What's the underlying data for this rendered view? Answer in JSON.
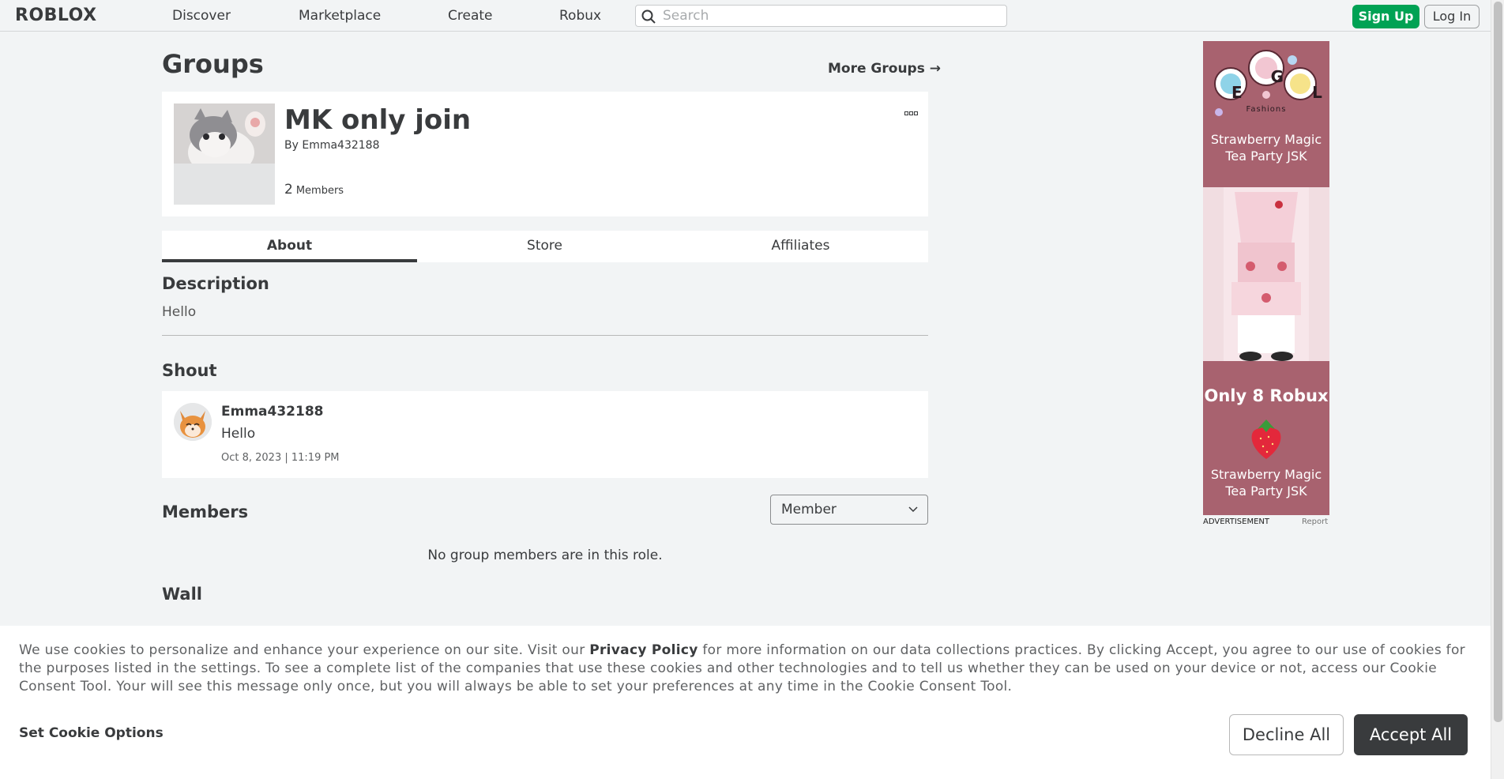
{
  "nav": {
    "logo": "ROBLOX",
    "links": [
      "Discover",
      "Marketplace",
      "Create",
      "Robux"
    ],
    "search_placeholder": "Search",
    "signup": "Sign Up",
    "login": "Log In"
  },
  "page": {
    "title": "Groups",
    "more_groups": "More Groups →"
  },
  "group": {
    "name": "MK only join",
    "owner_prefix": "By",
    "owner": "Emma432188",
    "member_count": "2",
    "member_label": "Members"
  },
  "tabs": [
    "About",
    "Store",
    "Affiliates"
  ],
  "about": {
    "description_heading": "Description",
    "description": "Hello",
    "shout_heading": "Shout",
    "shout": {
      "user": "Emma432188",
      "body": "Hello",
      "date": "Oct 8, 2023 | 11:19 PM"
    },
    "members_heading": "Members",
    "role_selected": "Member",
    "empty_members": "No group members are in this role.",
    "wall_heading": "Wall"
  },
  "ad": {
    "brand_letters": [
      "E",
      "G",
      "L"
    ],
    "brand_sub": "Fashions",
    "line1": "Strawberry Magic",
    "line2": "Tea Party JSK",
    "price": "Only 8 Robux",
    "line3": "Strawberry Magic",
    "line4": "Tea Party JSK",
    "label": "ADVERTISEMENT",
    "report": "Report",
    "color": "#a8626f"
  },
  "cookie": {
    "text_before": "We use cookies to personalize and enhance your experience on our site. Visit our ",
    "privacy_link": "Privacy Policy",
    "text_after": " for more information on our data collections practices. By clicking Accept, you agree to our use of cookies for the purposes listed in the settings. To see a complete list of the companies that use these cookies and other technologies and to tell us whether they can be used on your device or not, access our Cookie Consent Tool. Your will see this message only once, but you will always be able to set your preferences at any time in the Cookie Consent Tool.",
    "options": "Set Cookie Options",
    "decline": "Decline All",
    "accept": "Accept All"
  }
}
